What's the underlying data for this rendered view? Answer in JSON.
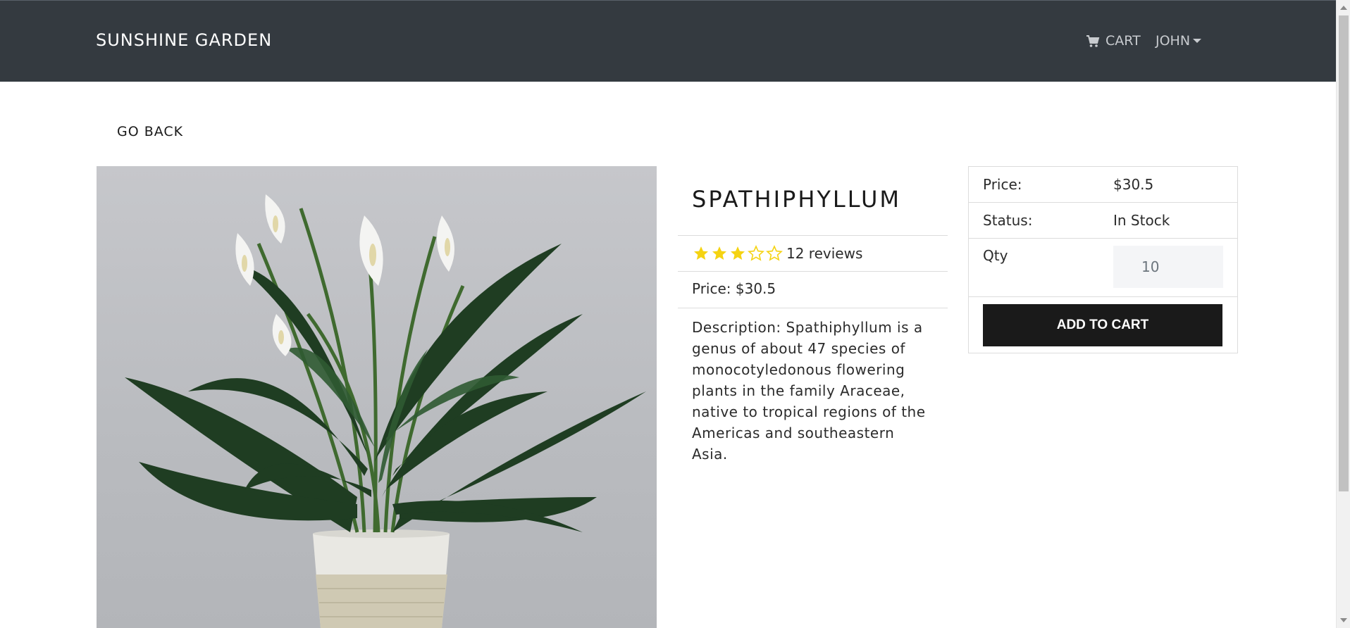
{
  "navbar": {
    "brand": "SUNSHINE GARDEN",
    "cart_label": "CART",
    "user_label": "JOHN",
    "cart_icon": "cart-icon",
    "background": "#343a40"
  },
  "back_link": "GO BACK",
  "product": {
    "image_icon": "plant-photo",
    "name": "SPATHIPHYLLUM",
    "rating": 3,
    "rating_max": 5,
    "reviews_text": "12 reviews",
    "price_text": "Price: $30.5",
    "description": "Description: Spathiphyllum is a genus of about 47 species of monocotyledonous flowering plants in the family Araceae, native to tropical regions of the Americas and southeastern Asia.",
    "star_color": "#f5d312"
  },
  "buy_card": {
    "price_label": "Price:",
    "price_value": "$30.5",
    "status_label": "Status:",
    "status_value": "In Stock",
    "qty_label": "Qty",
    "qty_value": "10",
    "add_button": "ADD TO CART"
  }
}
